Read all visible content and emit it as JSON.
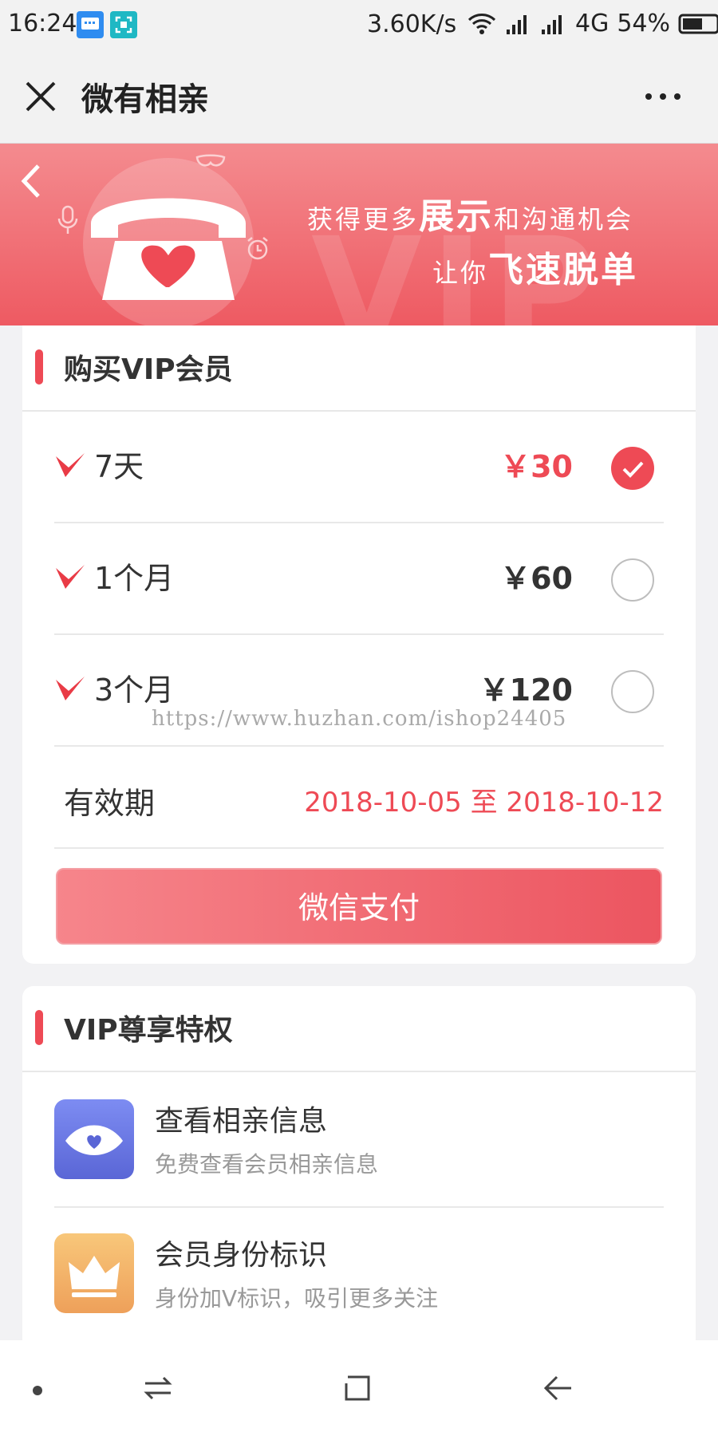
{
  "status_bar": {
    "time": "16:24",
    "speed": "3.60K/s",
    "network": "4G",
    "battery": "54%"
  },
  "title_bar": {
    "title": "微有相亲"
  },
  "banner": {
    "watermark": "VIP",
    "line1_pre": "获得更多",
    "line1_em": "展示",
    "line1_post": "和沟通机会",
    "line2_pre": "让你",
    "line2_em": "飞速脱单"
  },
  "purchase": {
    "heading": "购买VIP会员",
    "plans": [
      {
        "label": "7天",
        "price": "￥30",
        "selected": true
      },
      {
        "label": "1个月",
        "price": "￥60",
        "selected": false
      },
      {
        "label": "3个月",
        "price": "￥120",
        "selected": false
      }
    ],
    "validity_label": "有效期",
    "validity_value": "2018-10-05 至 2018-10-12",
    "pay_button": "微信支付"
  },
  "watermark_url": "https://www.huzhan.com/ishop24405",
  "privileges": {
    "heading": "VIP尊享特权",
    "items": [
      {
        "title": "查看相亲信息",
        "desc": "免费查看会员相亲信息",
        "icon": "eye-heart-icon"
      },
      {
        "title": "会员身份标识",
        "desc": "身份加V标识，吸引更多关注",
        "icon": "crown-icon"
      }
    ]
  },
  "colors": {
    "accent": "#ee4a55",
    "banner_top": "#f48b8f",
    "banner_bottom": "#ee5a62"
  }
}
